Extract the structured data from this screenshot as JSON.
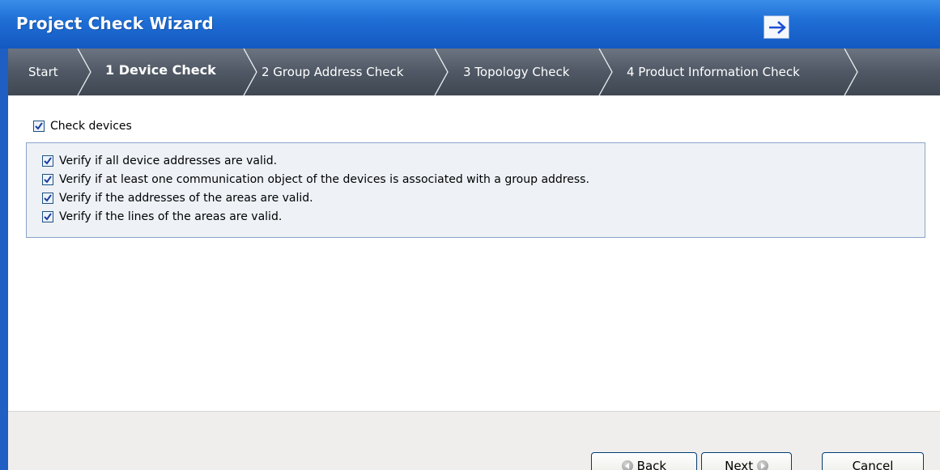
{
  "window": {
    "title": "Project Check Wizard"
  },
  "steps": [
    {
      "label": "Start"
    },
    {
      "label": "1 Device Check",
      "active": true
    },
    {
      "label": "2 Group Address Check"
    },
    {
      "label": "3 Topology Check"
    },
    {
      "label": "4 Product Information Check"
    }
  ],
  "device_check": {
    "main": {
      "label": "Check devices",
      "checked": true
    },
    "options": [
      {
        "label": "Verify if all device addresses are valid.",
        "checked": true
      },
      {
        "label": "Verify if at least one communication object of the devices is associated with a group address.",
        "checked": true
      },
      {
        "label": "Verify if the addresses of the areas are valid.",
        "checked": true
      },
      {
        "label": "Verify if the lines of the areas are valid.",
        "checked": true
      }
    ]
  },
  "footer": {
    "back_label": "Back",
    "next_label": "Next",
    "cancel_label": "Cancel"
  },
  "icons": {
    "title_button": "arrow-right-icon",
    "back": "back-arrow-icon",
    "next": "next-arrow-icon"
  },
  "colors": {
    "titlebar": "#1f6fd6",
    "stepsbar": "#4f5864",
    "checkmark": "#1c3fa0",
    "footer": "#f0eeec"
  }
}
